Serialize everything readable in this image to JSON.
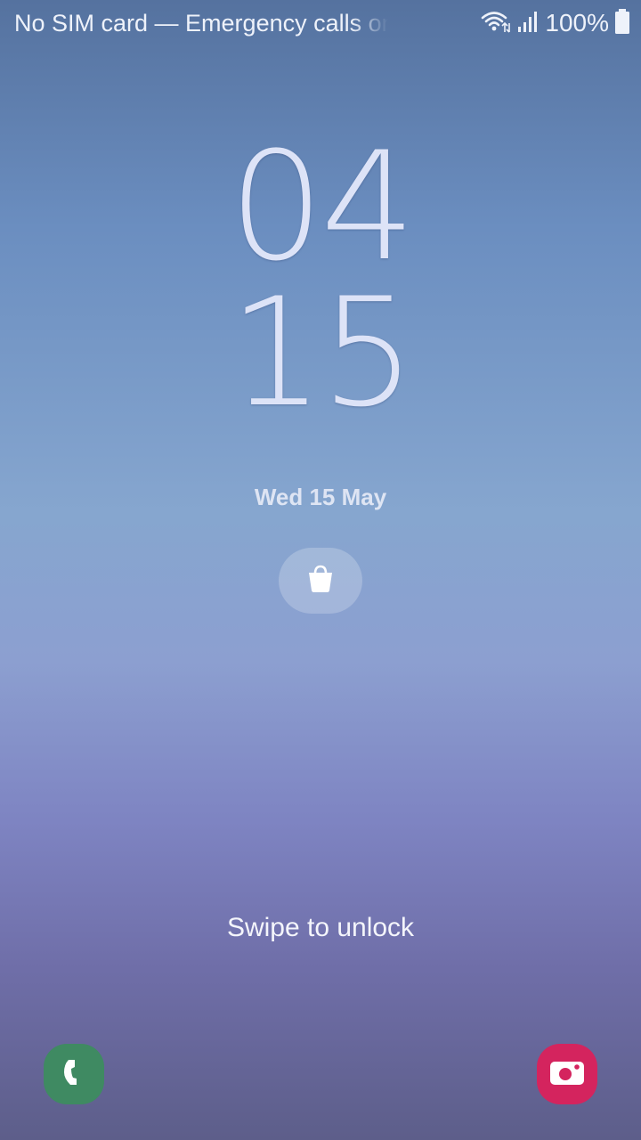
{
  "status_bar": {
    "carrier_text": "No SIM card — Emergency calls only",
    "battery_percent": "100%",
    "icons": [
      "wifi-icon",
      "signal-icon",
      "battery-icon"
    ]
  },
  "lockscreen": {
    "clock_hours": "04",
    "clock_minutes": "15",
    "date": "Wed 15 May",
    "notification_icon": "shopping-bag-icon",
    "swipe_text": "Swipe to unlock"
  },
  "shortcuts": {
    "left": {
      "icon": "phone-icon",
      "color": "#3f8a62"
    },
    "right": {
      "icon": "camera-icon",
      "color": "#d4245e"
    }
  }
}
